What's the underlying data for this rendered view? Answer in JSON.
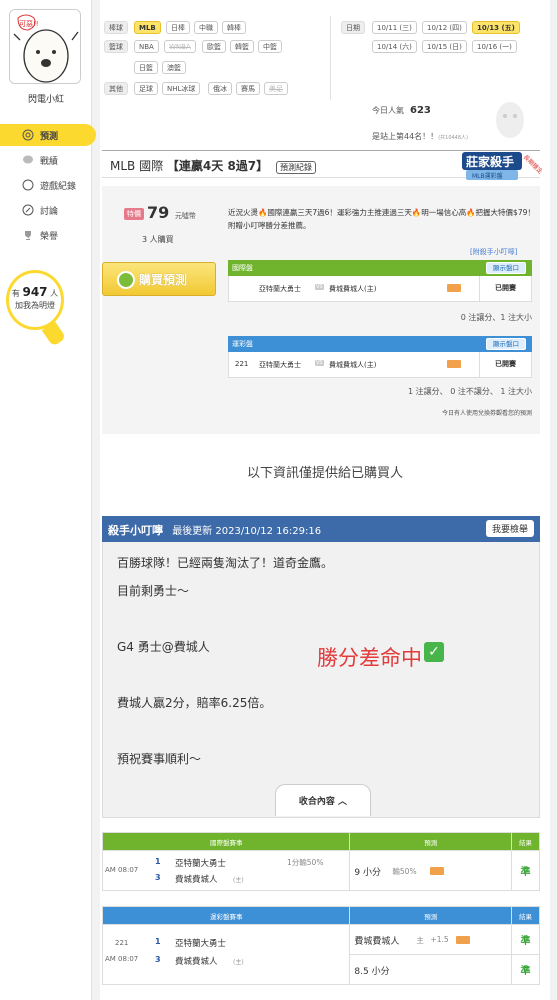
{
  "sidebar": {
    "username": "閃電小紅",
    "avatar_text": "可惡!!",
    "nav": [
      {
        "label": "預測",
        "icon": "target-icon",
        "active": true
      },
      {
        "label": "戰績",
        "icon": "chat-icon"
      },
      {
        "label": "遊戲紀錄",
        "icon": "clock-icon"
      },
      {
        "label": "討論",
        "icon": "discussion-icon"
      },
      {
        "label": "榮譽",
        "icon": "trophy-icon"
      }
    ],
    "fans_prefix": "有",
    "fans_count": "947",
    "fans_unit": "人",
    "fans_text": "加我為明燈"
  },
  "filters": {
    "baseball_label": "棒球",
    "baseball": [
      "MLB",
      "日棒",
      "中職",
      "韓棒"
    ],
    "basketball_label": "籃球",
    "basketball": [
      "NBA",
      "WNBA",
      "歐籃",
      "韓籃",
      "中籃",
      "日籃",
      "澳籃"
    ],
    "other_label": "其他",
    "other": [
      "足球",
      "NHL冰球",
      "俄冰",
      "賽馬",
      "美足"
    ],
    "date_label": "日期",
    "dates": [
      "10/11 (三)",
      "10/12 (四)",
      "10/13 (五)",
      "10/14 (六)",
      "10/15 (日)",
      "10/16 (一)"
    ]
  },
  "stats": {
    "popular_label": "今日人氣",
    "popular_value": "623",
    "rank_text": "是站上第44名！！",
    "rank_small": "(共10448人)"
  },
  "title": {
    "league": "MLB 國際",
    "streak": "【連贏4天 8過7】",
    "record_button": "預測紀錄",
    "badge_text": "莊家殺手",
    "badge_sub": "MLB運彩盤",
    "badge_ribbon": "長期穩定"
  },
  "purchase": {
    "price_tag": "特價",
    "price": "79",
    "price_unit": "元噓幣",
    "buyers": "3 人購買",
    "buy_button": "購買預測",
    "description": "近況火燙🔥國際連贏三天7過6！運彩強力主推連過三天🔥明一場信心高🔥把握大特價$79！ 附贈小叮嚀勝分差推薦。",
    "killer_link": "[附殺手小叮嚀]"
  },
  "intl_panel": {
    "header": "國際盤",
    "odds_button": "顯示盤口",
    "away": "亞特蘭大勇士",
    "vs": "VS",
    "home": "費城費城人(主)",
    "status": "已開賽",
    "footer": "0 注讓分、1 注大小"
  },
  "lottery_panel": {
    "header": "運彩盤",
    "odds_button": "顯示盤口",
    "game_no": "221",
    "away": "亞特蘭大勇士",
    "vs": "VS",
    "home": "費城費城人(主)",
    "status": "已開賽",
    "footer": "1 注讓分、 0 注不讓分、 1 注大小",
    "note": "今日有人使用兌換券觀看您的預測"
  },
  "info_label": "以下資訊僅提供給已購買人",
  "killer": {
    "title": "殺手小叮嚀",
    "updated": "最後更新 2023/10/12 16:29:16",
    "complain_button": "我要檢舉",
    "lines": [
      "百勝球隊！已經兩隻淘汰了！道奇金鷹。",
      "目前剩勇士～",
      "G4 勇士@費城人",
      "費城人贏2分，賠率6.25倍。",
      "預祝賽事順利～"
    ],
    "hit_text": "勝分差命中",
    "hit_check": "✓",
    "collapse_button": "收合內容 ︿"
  },
  "intl_result": {
    "headers": [
      "國際盤賽事",
      "預測",
      "結果"
    ],
    "time": "AM 08:07",
    "away_score": "1",
    "away": "亞特蘭大勇士",
    "home_score": "3",
    "home": "費城費城人",
    "home_mark": "(主)",
    "line": "1分輸50%",
    "pick": "9 小分",
    "pick_extra": "輸50%",
    "result": "準"
  },
  "lottery_result": {
    "headers": [
      "運彩盤賽事",
      "預測",
      "結果"
    ],
    "game_no": "221",
    "time": "AM 08:07",
    "away_score": "1",
    "away": "亞特蘭大勇士",
    "home_score": "3",
    "home": "費城費城人",
    "home_mark": "(主)",
    "pick1": "費城費城人",
    "pick1_mark": "主",
    "pick1_line": "+1.5",
    "pick2": "8.5 小分",
    "result1": "準",
    "result2": "準"
  },
  "colors": {
    "green": "#6fb42c",
    "blue": "#3d8fd6",
    "yellow": "#fcd92e",
    "navy": "#3d6aa8"
  }
}
